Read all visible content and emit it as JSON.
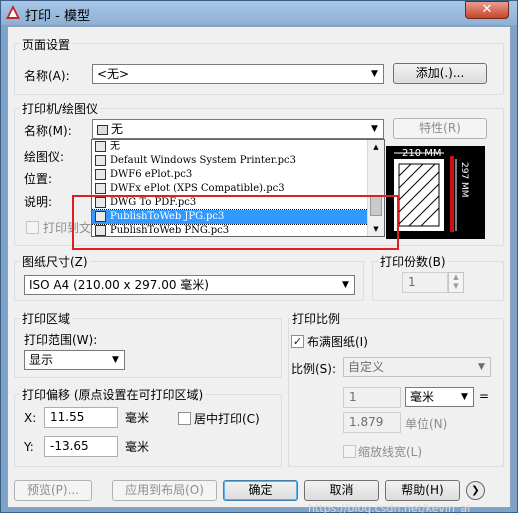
{
  "window": {
    "title": "打印 - 模型",
    "close_glyph": "✕"
  },
  "page_setup": {
    "group_title": "页面设置",
    "name_label": "名称(A):",
    "name_value": "<无>",
    "add_button": "添加(.)..."
  },
  "printer": {
    "group_title": "打印机/绘图仪",
    "name_label": "名称(M):",
    "name_value": "无",
    "properties_button": "特性(R)",
    "plotter_label": "绘图仪:",
    "location_label": "位置:",
    "description_label": "说明:",
    "print_to_file_label": "打印到文件(F)",
    "dropdown_items": [
      "无",
      "Default Windows System Printer.pc3",
      "DWF6 ePlot.pc3",
      "DWFx ePlot (XPS Compatible).pc3",
      "DWG To PDF.pc3",
      "PublishToWeb JPG.pc3",
      "PublishToWeb PNG.pc3"
    ],
    "selected_index": 5,
    "preview_width_label": "210 MM",
    "preview_height_label": "297 MM"
  },
  "paper_size": {
    "group_title": "图纸尺寸(Z)",
    "value": "ISO A4 (210.00 x 297.00 毫米)"
  },
  "copies": {
    "group_title": "打印份数(B)",
    "value": "1"
  },
  "plot_area": {
    "group_title": "打印区域",
    "range_label": "打印范围(W):",
    "range_value": "显示"
  },
  "plot_offset": {
    "group_title": "打印偏移 (原点设置在可打印区域)",
    "x_label": "X:",
    "x_value": "11.55",
    "x_unit": "毫米",
    "y_label": "Y:",
    "y_value": "-13.65",
    "y_unit": "毫米",
    "center_label": "居中打印(C)"
  },
  "plot_scale": {
    "group_title": "打印比例",
    "fit_label": "布满图纸(I)",
    "fit_checked": true,
    "scale_label": "比例(S):",
    "scale_value": "自定义",
    "numerator": "1",
    "unit_value": "毫米",
    "equals": "=",
    "denominator": "1.879",
    "unit_label": "单位(N)",
    "lineweight_label": "缩放线宽(L)"
  },
  "footer": {
    "preview_button": "预览(P)...",
    "apply_layout_button": "应用到布局(O)",
    "ok_button": "确定",
    "cancel_button": "取消",
    "help_button": "帮助(H)",
    "more_glyph": "❯",
    "watermark": "https://blog.csdn.net/kevin_ai"
  }
}
